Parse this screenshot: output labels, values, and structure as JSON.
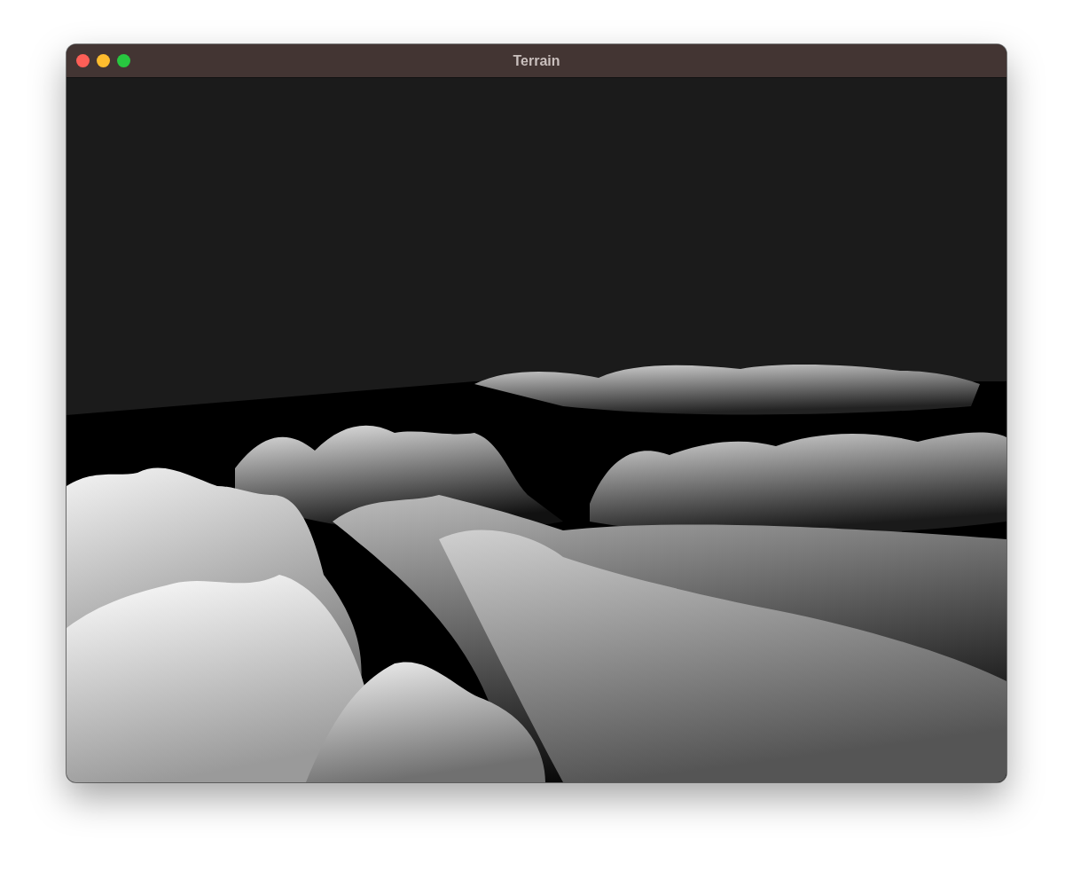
{
  "window": {
    "title": "Terrain",
    "buttons": [
      {
        "color": "#fe5f57"
      },
      {
        "color": "#febc2e"
      },
      {
        "color": "#28c840"
      }
    ]
  }
}
